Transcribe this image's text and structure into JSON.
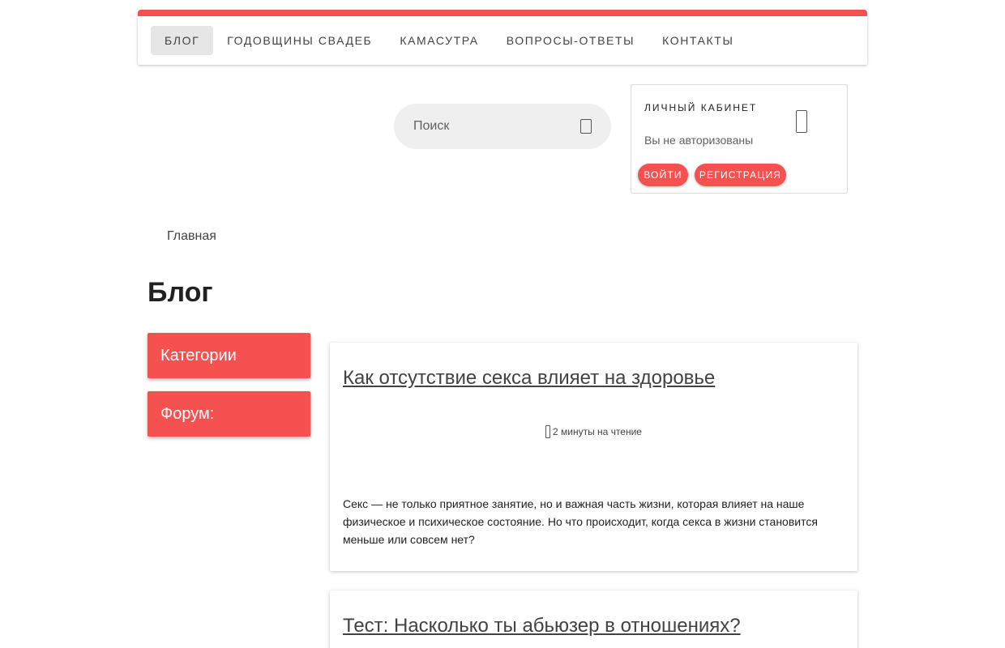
{
  "nav": {
    "items": [
      {
        "label": "Блог",
        "active": true
      },
      {
        "label": "Годовщины свадеб",
        "active": false
      },
      {
        "label": "Камасутра",
        "active": false
      },
      {
        "label": "Вопросы-ответы",
        "active": false
      },
      {
        "label": "Контакты",
        "active": false
      }
    ]
  },
  "search": {
    "placeholder": "Поиск",
    "icon": "search-icon"
  },
  "account": {
    "title": "Личный кабинет",
    "status": "Вы не авторизованы",
    "icon": "user-icon",
    "login_label": "Войти",
    "register_label": "Регистрация"
  },
  "breadcrumb": {
    "home": "Главная"
  },
  "page": {
    "title": "Блог"
  },
  "sidebar": {
    "categories_label": "Категории",
    "forum_label": "Форум:"
  },
  "posts": [
    {
      "title": "Как отсутствие секса влияет на здоровье",
      "read_time": "2 минуты на чтение",
      "excerpt": "Секс — не только приятное занятие, но и важная часть жизни, которая влияет на наше физическое и психическое состояние. Но что происходит, когда секса в жизни становится меньше или совсем нет?"
    },
    {
      "title": "Тест: Насколько ты абьюзер в отношениях?"
    }
  ],
  "colors": {
    "accent": "#f55151",
    "nav_active_bg": "#e6e6e6",
    "search_bg": "#efefef"
  }
}
